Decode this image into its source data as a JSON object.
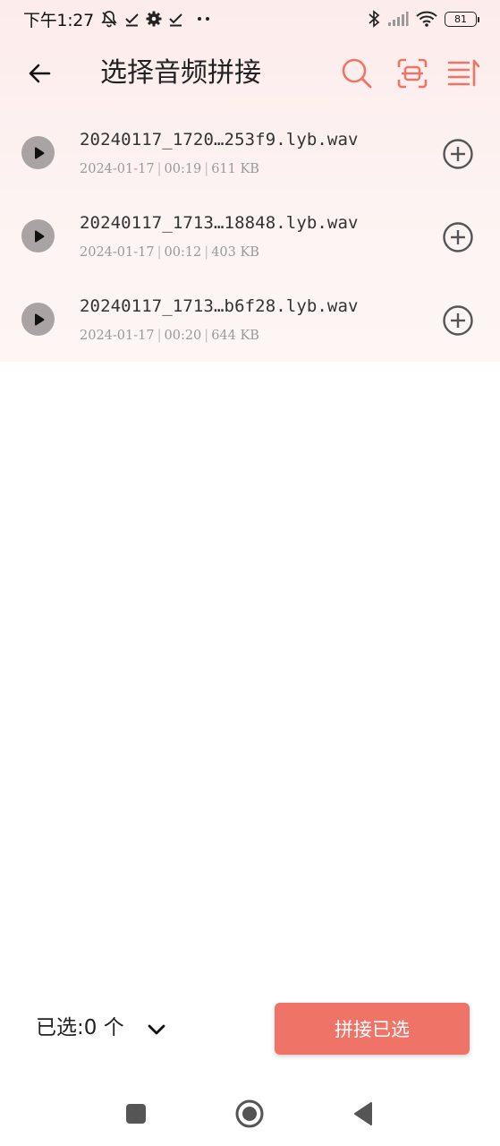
{
  "status_bar": {
    "time": "下午1:27",
    "battery": "81",
    "icons": [
      "mute-bell-icon",
      "check-icon",
      "gear-icon",
      "check-icon",
      "more-dots-icon",
      "bluetooth-icon",
      "signal-icon",
      "wifi-icon",
      "battery-icon"
    ]
  },
  "app_bar": {
    "title": "选择音频拼接",
    "icons": [
      "back-arrow-icon",
      "search-icon",
      "scan-icon",
      "sort-icon"
    ],
    "accent_color": "#ef7467"
  },
  "files": [
    {
      "name": "20240117_1720…253f9.lyb.wav",
      "date": "2024-01-17",
      "duration": "00:19",
      "size": "611 KB"
    },
    {
      "name": "20240117_1713…18848.lyb.wav",
      "date": "2024-01-17",
      "duration": "00:12",
      "size": "403 KB"
    },
    {
      "name": "20240117_1713…b6f28.lyb.wav",
      "date": "2024-01-17",
      "duration": "00:20",
      "size": "644 KB"
    }
  ],
  "footer": {
    "selected_label": "已选:0 个",
    "merge_label": "拼接已选"
  },
  "nav_icons": [
    "square-icon",
    "home-circle-icon",
    "back-triangle-icon"
  ]
}
